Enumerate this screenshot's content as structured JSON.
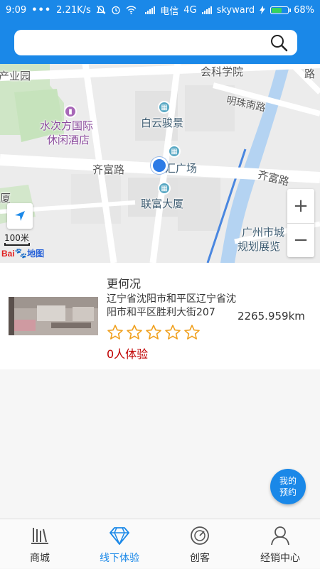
{
  "status_bar": {
    "time": "9:09",
    "dots": "•••",
    "speed": "2.21K/s",
    "carrier1": "电信",
    "network": "4G",
    "carrier2": "skyward",
    "battery": "68%",
    "battery_level": 0.68
  },
  "search": {
    "value": "",
    "placeholder": ""
  },
  "map": {
    "labels": {
      "industrial_park": "产业园",
      "science_academy": "会科学院",
      "hotel_line1": "水次方国际",
      "hotel_line2": "休闲酒店",
      "mingzhu_road": "明珠南路",
      "baiyun": "白云骏景",
      "qifu_road_left": "齐富路",
      "plaza": "汇广场",
      "qifu_road_right": "齐富路",
      "lianfu": "联富大厦",
      "xia": "厦",
      "guangzhou_line1": "广州市城",
      "guangzhou_line2": "规划展览",
      "road_right": "路"
    },
    "zoom_in": "+",
    "zoom_out": "−",
    "scale": "100米",
    "logo_bai": "Bai",
    "logo_du": "地图"
  },
  "store": {
    "name": "更何况",
    "address": "辽宁省沈阳市和平区辽宁省沈阳市和平区胜利大街207",
    "distance": "2265.959km",
    "rating": 0,
    "rating_max": 5,
    "experience_count": "0人体验"
  },
  "fab": {
    "line1": "我的",
    "line2": "预约"
  },
  "nav": {
    "items": [
      {
        "label": "商城",
        "icon": "mall-icon"
      },
      {
        "label": "线下体验",
        "icon": "diamond-icon"
      },
      {
        "label": "创客",
        "icon": "maker-icon"
      },
      {
        "label": "经销中心",
        "icon": "user-icon"
      }
    ]
  },
  "colors": {
    "primary": "#1a88e8",
    "star": "#f0a01e",
    "experience": "#c00000"
  }
}
